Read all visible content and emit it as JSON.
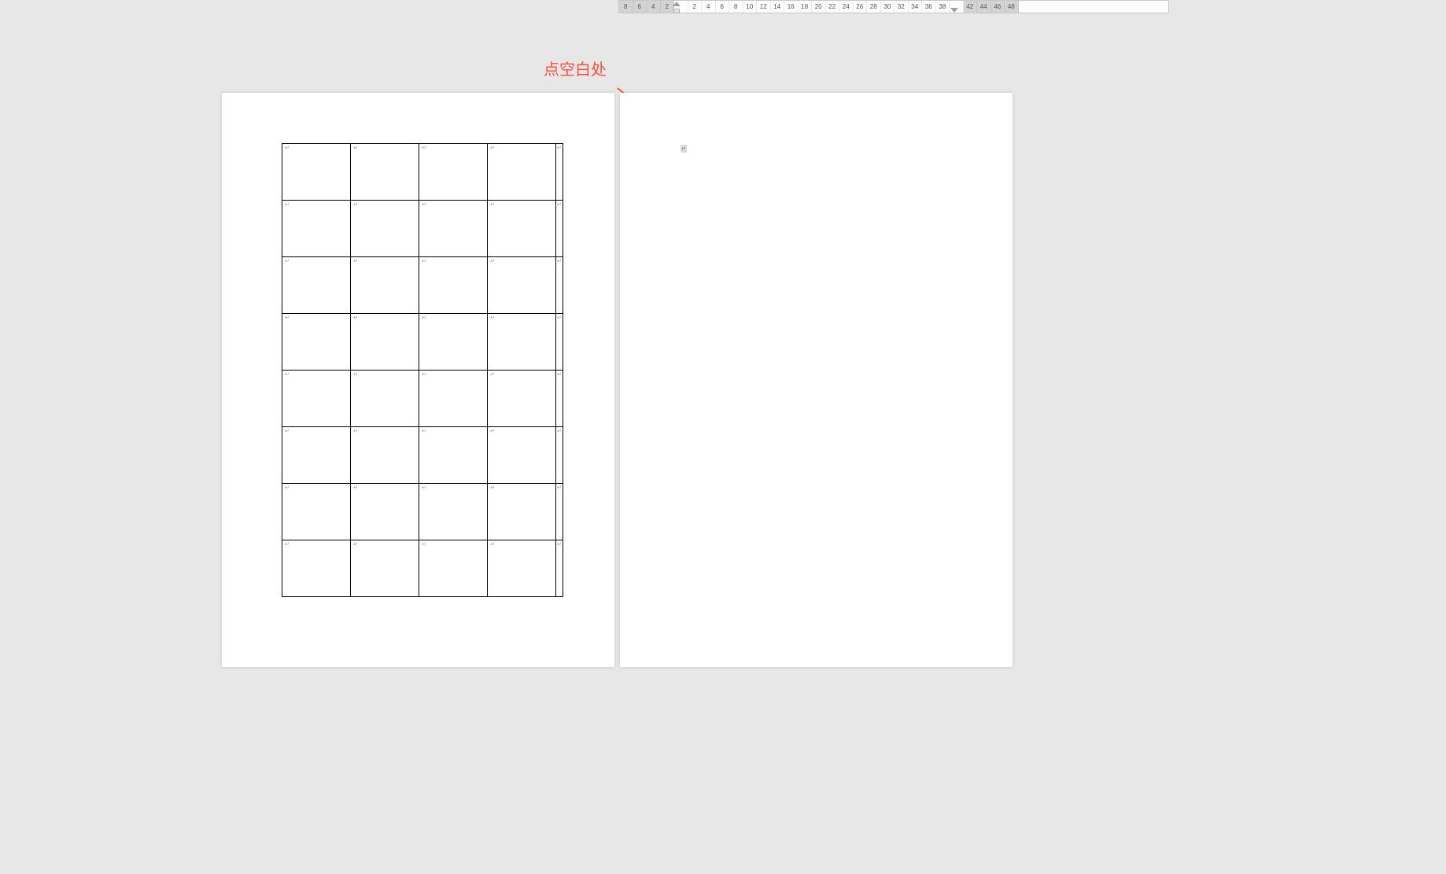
{
  "annotation": {
    "text": "点空白处",
    "color": "#fb4f3d"
  },
  "ruler": {
    "left_negative_ticks": [
      8,
      6,
      4,
      2
    ],
    "positive_ticks": [
      2,
      4,
      6,
      8,
      10,
      12,
      14,
      16,
      18,
      20,
      22,
      24,
      26,
      28,
      30,
      32,
      34,
      36,
      38
    ],
    "right_gray_ticks": [
      42,
      44,
      46,
      48
    ]
  },
  "table": {
    "rows": 8,
    "cols": 4,
    "cell_mark": "↵"
  },
  "page2": {
    "cursor_mark": "↵"
  }
}
